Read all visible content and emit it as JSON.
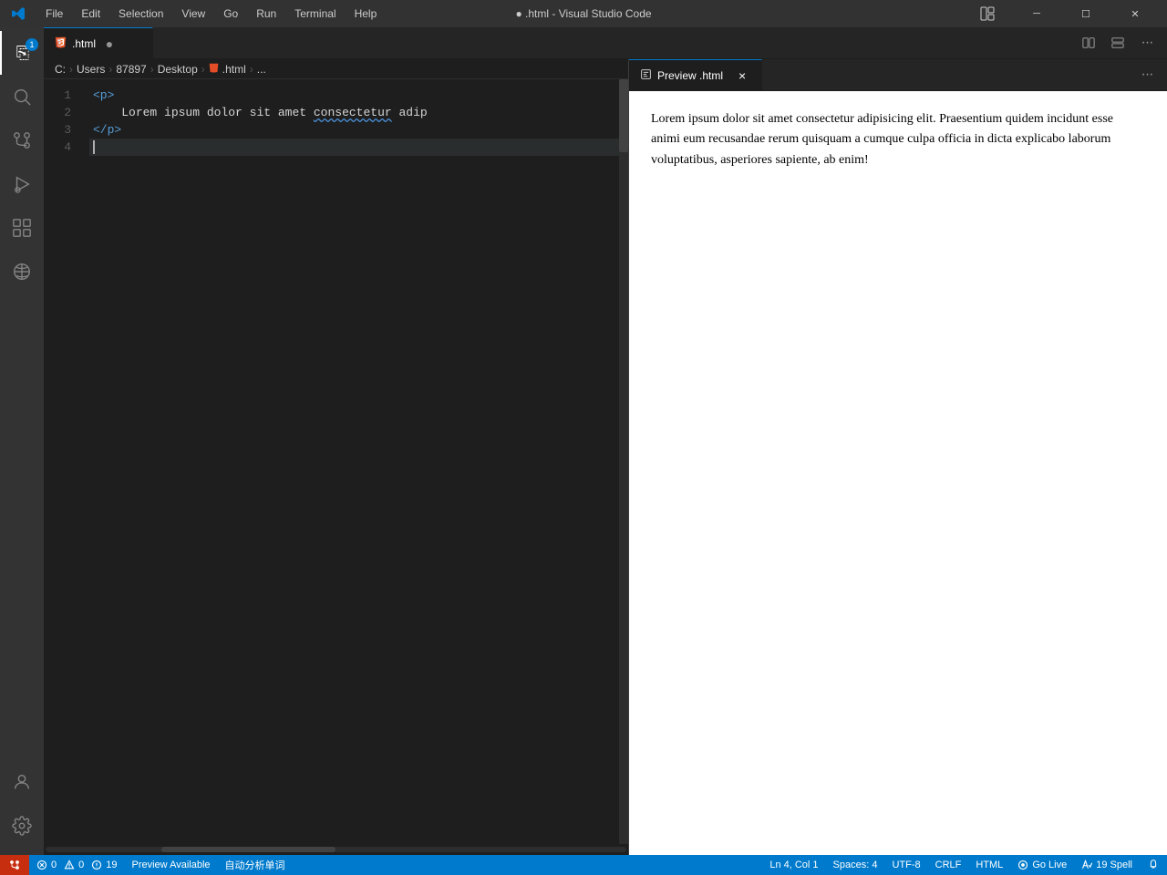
{
  "titleBar": {
    "title": "● .html - Visual Studio Code",
    "menuItems": [
      "File",
      "Edit",
      "Selection",
      "View",
      "Go",
      "Run",
      "Terminal",
      "Help"
    ],
    "windowControls": {
      "layout": "⊞",
      "minimize": "─",
      "maximize": "☐",
      "close": "✕"
    }
  },
  "activityBar": {
    "icons": [
      {
        "name": "explorer-icon",
        "symbol": "⎘",
        "badge": "1",
        "active": true
      },
      {
        "name": "search-icon",
        "symbol": "🔍",
        "badge": null,
        "active": false
      },
      {
        "name": "source-control-icon",
        "symbol": "⎇",
        "badge": null,
        "active": false
      },
      {
        "name": "run-debug-icon",
        "symbol": "▷",
        "badge": null,
        "active": false
      },
      {
        "name": "extensions-icon",
        "symbol": "⧉",
        "badge": null,
        "active": false
      },
      {
        "name": "remote-explorer-icon",
        "symbol": "⊡",
        "badge": null,
        "active": false
      }
    ],
    "bottomIcons": [
      {
        "name": "accounts-icon",
        "symbol": "👤"
      },
      {
        "name": "settings-icon",
        "symbol": "⚙"
      }
    ]
  },
  "editorTab": {
    "filename": ".html",
    "modified": true,
    "icon": "html-icon"
  },
  "previewTab": {
    "label": "Preview .html",
    "icon": "preview-icon"
  },
  "breadcrumb": {
    "parts": [
      "C:",
      "Users",
      "87897",
      "Desktop",
      ".html",
      "..."
    ]
  },
  "codeLines": [
    {
      "number": "1",
      "content": "<p>",
      "tokens": [
        {
          "text": "<p>",
          "class": "tag"
        }
      ]
    },
    {
      "number": "2",
      "content": "    Lorem ipsum dolor sit amet consectetur adip",
      "tokens": [
        {
          "text": "    ",
          "class": "text-content"
        },
        {
          "text": "Lorem ipsum dolor sit amet ",
          "class": "text-content"
        },
        {
          "text": "consectetur",
          "class": "underline-squiggle"
        },
        {
          "text": " adip",
          "class": "text-content"
        }
      ]
    },
    {
      "number": "3",
      "content": "</p>",
      "tokens": [
        {
          "text": "</p>",
          "class": "tag"
        }
      ]
    },
    {
      "number": "4",
      "content": "",
      "tokens": []
    }
  ],
  "previewContent": {
    "text": "Lorem ipsum dolor sit amet consectetur adipisicing elit. Praesentium quidem incidunt esse animi eum recusandae rerum quisquam a cumque culpa officia in dicta explicabo laborum voluptatibus, asperiores sapiente, ab enim!"
  },
  "statusBar": {
    "errors": "0",
    "warnings": "0",
    "info": "19",
    "previewAvailable": "Preview Available",
    "autoAnalysis": "自动分析单词",
    "position": "Ln 4, Col 1",
    "spaces": "Spaces: 4",
    "encoding": "UTF-8",
    "lineEnding": "CRLF",
    "language": "HTML",
    "goLive": "Go Live",
    "spell": "19 Spell",
    "notifications": ""
  }
}
